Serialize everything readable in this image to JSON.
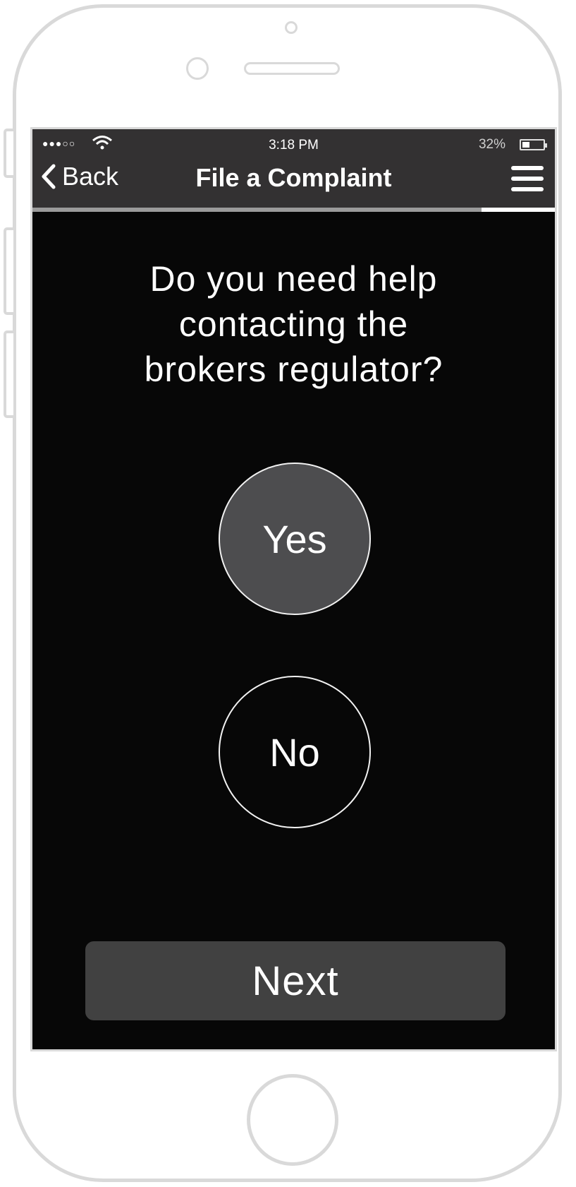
{
  "status_bar": {
    "signal": "●●●○○",
    "time": "3:18 PM",
    "battery_percent": "32%",
    "battery_level": 0.32
  },
  "nav": {
    "back_label": "Back",
    "title": "File a Complaint",
    "menu_icon": "hamburger-icon",
    "progress_fraction": 0.86
  },
  "question": {
    "line1": "Do you need help",
    "line2": "contacting the",
    "line3": "brokers regulator?"
  },
  "options": {
    "yes_label": "Yes",
    "no_label": "No",
    "selected": "Yes"
  },
  "footer": {
    "next_label": "Next"
  },
  "colors": {
    "screen_bg": "#070707",
    "navbar_bg": "#333132",
    "selected_option": "#4d4d4f",
    "button_bg": "#414141"
  }
}
